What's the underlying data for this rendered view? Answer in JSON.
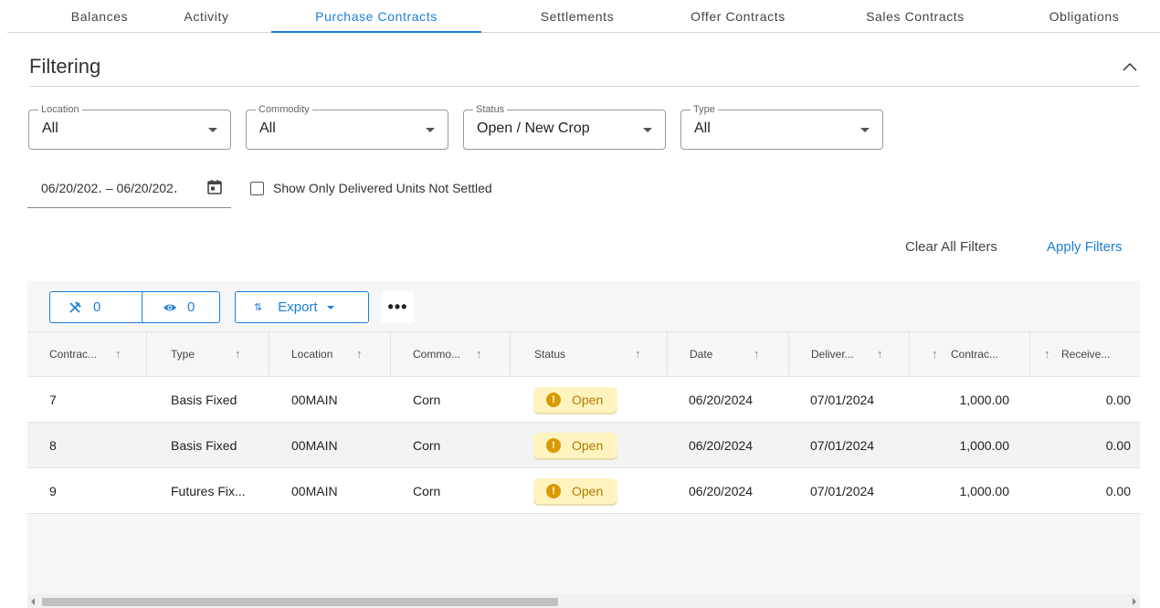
{
  "tabs": [
    {
      "label": "Balances",
      "active": false
    },
    {
      "label": "Activity",
      "active": false
    },
    {
      "label": "Purchase Contracts",
      "active": true
    },
    {
      "label": "Settlements",
      "active": false
    },
    {
      "label": "Offer Contracts",
      "active": false
    },
    {
      "label": "Sales Contracts",
      "active": false
    },
    {
      "label": "Obligations",
      "active": false
    }
  ],
  "filtering": {
    "title": "Filtering",
    "location": {
      "label": "Location",
      "value": "All"
    },
    "commodity": {
      "label": "Commodity",
      "value": "All"
    },
    "status": {
      "label": "Status",
      "value": "Open / New Crop"
    },
    "type": {
      "label": "Type",
      "value": "All"
    },
    "date_range": "06/20/202․ – 06/20/202․",
    "delivered_checkbox_label": "Show Only Delivered Units Not Settled",
    "clear_label": "Clear All Filters",
    "apply_label": "Apply Filters"
  },
  "toolbar": {
    "pinned_count": "0",
    "visible_count": "0",
    "export_label": "Export",
    "more_label": "•••"
  },
  "columns": [
    "Contrac...",
    "Type",
    "Location",
    "Commo...",
    "Status",
    "Date",
    "Deliver...",
    "Contrac...",
    "Receive..."
  ],
  "rows": [
    {
      "contract": "7",
      "type": "Basis Fixed",
      "location": "00MAIN",
      "commodity": "Corn",
      "status": "Open",
      "date": "06/20/2024",
      "delivery": "07/01/2024",
      "quantity": "1,000.00",
      "received": "0.00"
    },
    {
      "contract": "8",
      "type": "Basis Fixed",
      "location": "00MAIN",
      "commodity": "Corn",
      "status": "Open",
      "date": "06/20/2024",
      "delivery": "07/01/2024",
      "quantity": "1,000.00",
      "received": "0.00"
    },
    {
      "contract": "9",
      "type": "Futures Fix...",
      "location": "00MAIN",
      "commodity": "Corn",
      "status": "Open",
      "date": "06/20/2024",
      "delivery": "07/01/2024",
      "quantity": "1,000.00",
      "received": "0.00"
    }
  ],
  "colors": {
    "accent": "#1c7ed6",
    "status_open_bg": "#fff3c0",
    "status_open_text": "#b07a00",
    "warning_icon": "#d99a00"
  },
  "icons": {
    "collapse": "chevron-up-icon",
    "calendar": "calendar-icon",
    "pin": "pin-off-icon",
    "eye": "eye-icon",
    "export": "sort-arrows-icon",
    "status": "warning-circle-icon"
  }
}
